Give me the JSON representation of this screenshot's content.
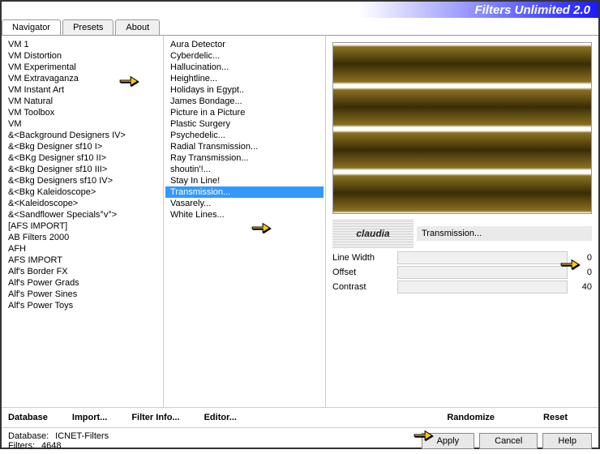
{
  "header": {
    "title": "Filters Unlimited 2.0"
  },
  "tabs": [
    "Navigator",
    "Presets",
    "About"
  ],
  "active_tab": 0,
  "categories": [
    "VM 1",
    "VM Distortion",
    "VM Experimental",
    "VM Extravaganza",
    "VM Instant Art",
    "VM Natural",
    "VM Toolbox",
    "VM",
    "&<Background Designers IV>",
    "&<Bkg Designer sf10 I>",
    "&<BKg Designer sf10 II>",
    "&<Bkg Designer sf10 III>",
    "&<Bkg Designers sf10 IV>",
    "&<Bkg Kaleidoscope>",
    "&<Kaleidoscope>",
    "&<Sandflower Specials°v°>",
    "[AFS IMPORT]",
    "AB Filters 2000",
    "AFH",
    "AFS IMPORT",
    "Alf's Border FX",
    "Alf's Power Grads",
    "Alf's Power Sines",
    "Alf's Power Toys"
  ],
  "filters": [
    "Aura Detector",
    "Cyberdelic...",
    "Hallucination...",
    "Heightline...",
    "Holidays in Egypt..",
    "James Bondage...",
    "Picture in a Picture",
    "Plastic Surgery",
    "Psychedelic...",
    "Radial Transmission...",
    "Ray Transmission...",
    "shoutin'!...",
    "Stay In Line!",
    "Transmission...",
    "Vasarely...",
    "White Lines..."
  ],
  "selected_filter_index": 13,
  "logo_text": "claudia",
  "current_filter": "Transmission...",
  "sliders": [
    {
      "label": "Line Width",
      "value": 0
    },
    {
      "label": "Offset",
      "value": 0
    },
    {
      "label": "Contrast",
      "value": 40
    }
  ],
  "bottom_links": {
    "database": "Database",
    "import": "Import...",
    "filter_info": "Filter Info...",
    "editor": "Editor...",
    "randomize": "Randomize",
    "reset": "Reset"
  },
  "status": {
    "db_label": "Database:",
    "db_value": "ICNET-Filters",
    "filters_label": "Filters:",
    "filters_value": "4648"
  },
  "buttons": {
    "apply": "Apply",
    "cancel": "Cancel",
    "help": "Help"
  }
}
